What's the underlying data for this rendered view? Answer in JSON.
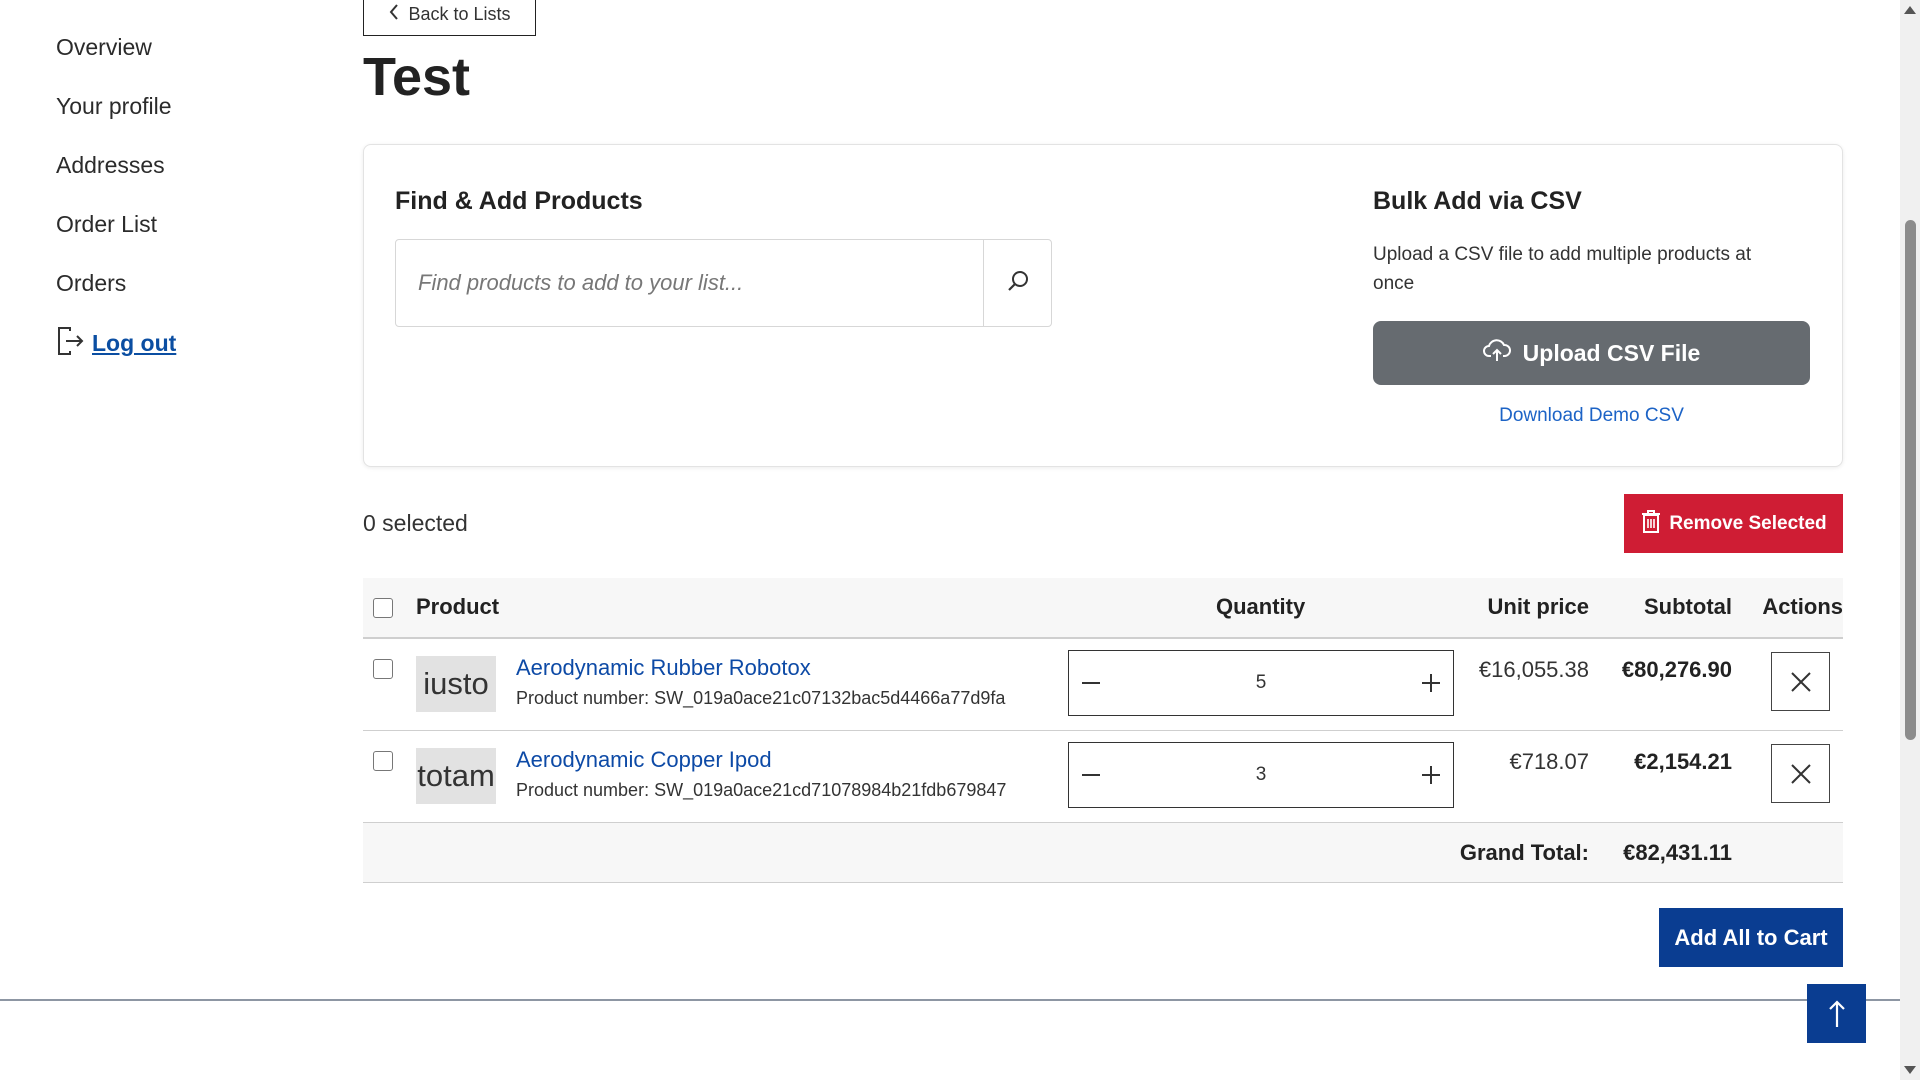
{
  "sidebar": {
    "items": [
      {
        "label": "Overview"
      },
      {
        "label": "Your profile"
      },
      {
        "label": "Addresses"
      },
      {
        "label": "Order List"
      },
      {
        "label": "Orders"
      }
    ],
    "logout_label": "Log out"
  },
  "header": {
    "back_label": "Back to Lists",
    "title": "Test"
  },
  "find": {
    "title": "Find & Add Products",
    "placeholder": "Find products to add to your list..."
  },
  "bulk": {
    "title": "Bulk Add via CSV",
    "description": "Upload a CSV file to add multiple products at once",
    "upload_label": "Upload CSV File",
    "demo_label": "Download Demo CSV"
  },
  "selection": {
    "count_text": "0 selected",
    "remove_label": "Remove Selected"
  },
  "table": {
    "headers": {
      "product": "Product",
      "quantity": "Quantity",
      "unit_price": "Unit price",
      "subtotal": "Subtotal",
      "actions": "Actions"
    },
    "rows": [
      {
        "thumb_text": "iusto",
        "name": "Aerodynamic Rubber Robotox",
        "number": "Product number: SW_019a0ace21c07132bac5d4466a77d9fa",
        "quantity": "5",
        "unit_price": "€16,055.38",
        "subtotal": "€80,276.90"
      },
      {
        "thumb_text": "totam",
        "name": "Aerodynamic Copper Ipod",
        "number": "Product number: SW_019a0ace21cd71078984b21fdb679847",
        "quantity": "3",
        "unit_price": "€718.07",
        "subtotal": "€2,154.21"
      }
    ],
    "grand_total_label": "Grand Total:",
    "grand_total_value": "€82,431.11"
  },
  "actions": {
    "add_all_label": "Add All to Cart"
  },
  "colors": {
    "primary": "#0a3d91",
    "danger": "#cf1d34",
    "upload_bg": "#666b70",
    "link": "#1c63c6"
  }
}
